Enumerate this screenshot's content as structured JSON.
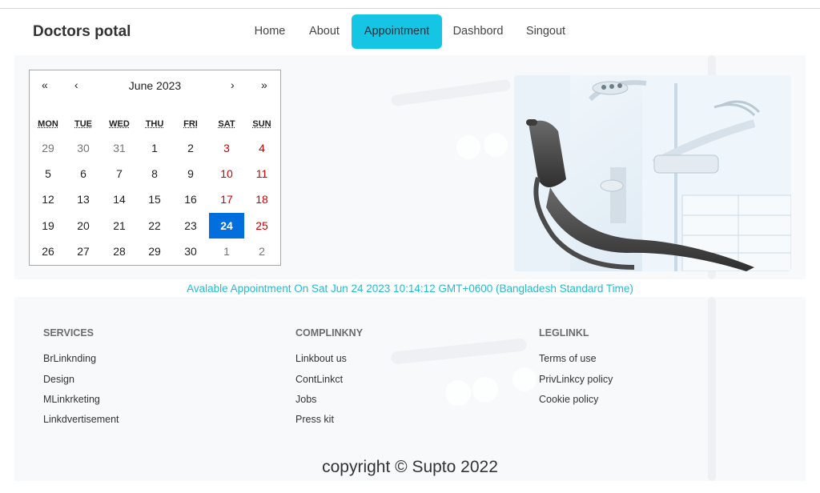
{
  "brand": "Doctors potal",
  "nav": {
    "items": [
      {
        "label": "Home"
      },
      {
        "label": "About"
      },
      {
        "label": "Appointment",
        "active": true
      },
      {
        "label": "Dashbord"
      },
      {
        "label": "Singout"
      }
    ]
  },
  "calendar": {
    "first": "«",
    "prev": "‹",
    "label": "June 2023",
    "next": "›",
    "last": "»",
    "weekdays": [
      "MON",
      "TUE",
      "WED",
      "THU",
      "FRI",
      "SAT",
      "SUN"
    ],
    "rows": [
      [
        "29",
        "30",
        "31",
        "1",
        "2",
        "3",
        "4"
      ],
      [
        "5",
        "6",
        "7",
        "8",
        "9",
        "10",
        "11"
      ],
      [
        "12",
        "13",
        "14",
        "15",
        "16",
        "17",
        "18"
      ],
      [
        "19",
        "20",
        "21",
        "22",
        "23",
        "24",
        "25"
      ],
      [
        "26",
        "27",
        "28",
        "29",
        "30",
        "1",
        "2"
      ]
    ],
    "selected": "24"
  },
  "availability": "Avalable Appointment On Sat Jun 24 2023 10:14:12 GMT+0600 (Bangladesh Standard Time)",
  "footer": {
    "columns": [
      {
        "heading": "SERVICES",
        "links": [
          "BrLinknding",
          "Design",
          "MLinkrketing",
          "Linkdvertisement"
        ]
      },
      {
        "heading": "COMPLINKNY",
        "links": [
          "Linkbout us",
          "ContLinkct",
          "Jobs",
          "Press kit"
        ]
      },
      {
        "heading": "LEGLINKL",
        "links": [
          "Terms of use",
          "PrivLinkcy policy",
          "Cookie policy"
        ]
      }
    ],
    "copyright": "copyright © Supto 2022"
  },
  "colors": {
    "accent": "#14c6e3",
    "selected_day": "#006edc",
    "weekend": "#d10000",
    "availability_text": "#20bcd2"
  }
}
